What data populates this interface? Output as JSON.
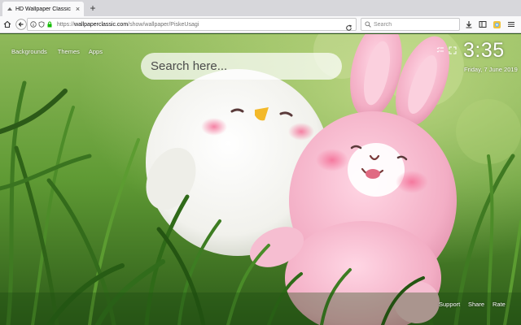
{
  "browser": {
    "tab": {
      "title": "HD Wallpaper Classic - PiskeUsagi",
      "close": "×"
    },
    "new_tab": "+",
    "url": {
      "scheme": "https://",
      "domain": "wallpaperclassic.com",
      "path": "/show/wallpaper/PiskeUsagi"
    },
    "search_placeholder": "Search",
    "icons": [
      "home-icon",
      "back-icon",
      "info-icon",
      "shield-icon",
      "lock-icon",
      "reload-icon",
      "search-icon",
      "download-icon",
      "sidebar-icon",
      "extension-icon",
      "menu-icon"
    ]
  },
  "newtab": {
    "nav": {
      "backgrounds": "Backgrounds",
      "themes": "Themes",
      "apps": "Apps"
    },
    "search_placeholder": "Search here...",
    "clock": {
      "time": "3:35",
      "date": "Friday, 7 June 2019"
    },
    "footer": {
      "support": "Support",
      "share": "Share",
      "rate": "Rate"
    },
    "icons": [
      "expand-icon",
      "checklist-icon"
    ]
  },
  "colors": {
    "chrome_bg": "#f9f9fa",
    "tabstrip_bg": "#d7d7db",
    "plush_pink": "#f4b3c6",
    "grass_green": "#4f8f2a"
  }
}
